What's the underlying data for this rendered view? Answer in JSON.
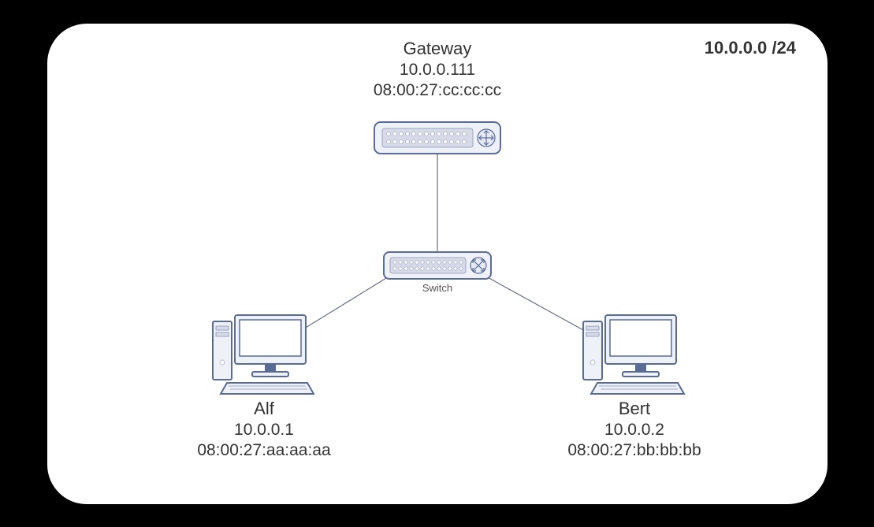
{
  "network": {
    "subnet": "10.0.0.0 /24",
    "gateway": {
      "name": "Gateway",
      "ip": "10.0.0.111",
      "mac": "08:00:27:cc:cc:cc"
    },
    "switch": {
      "label": "Switch"
    },
    "hosts": {
      "alf": {
        "name": "Alf",
        "ip": "10.0.0.1",
        "mac": "08:00:27:aa:aa:aa"
      },
      "bert": {
        "name": "Bert",
        "ip": "10.0.0.2",
        "mac": "08:00:27:bb:bb:bb"
      }
    }
  }
}
